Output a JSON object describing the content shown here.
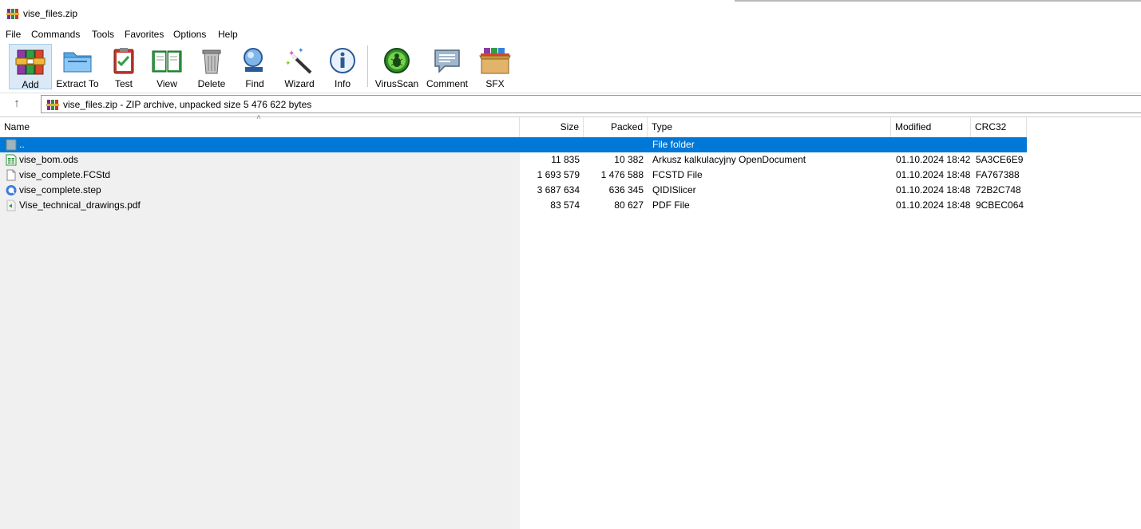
{
  "window": {
    "title": "vise_files.zip",
    "app_icon": "winrar-books-icon"
  },
  "menu": {
    "file": "File",
    "commands": "Commands",
    "tools": "Tools",
    "favorites": "Favorites",
    "options": "Options",
    "help": "Help"
  },
  "toolbar": {
    "add": "Add",
    "extract_to": "Extract To",
    "test": "Test",
    "view": "View",
    "delete": "Delete",
    "find": "Find",
    "wizard": "Wizard",
    "info": "Info",
    "virusscan": "VirusScan",
    "comment": "Comment",
    "sfx": "SFX"
  },
  "address": {
    "up_icon": "up-arrow-icon",
    "path": "vise_files.zip - ZIP archive, unpacked size 5 476 622 bytes"
  },
  "columns": {
    "name": "Name",
    "size": "Size",
    "packed": "Packed",
    "type": "Type",
    "modified": "Modified",
    "crc32": "CRC32"
  },
  "files": [
    {
      "name": "..",
      "size": "",
      "packed": "",
      "type": "File folder",
      "modified": "",
      "crc32": "",
      "icon": "parent-folder-icon"
    },
    {
      "name": "vise_bom.ods",
      "size": "11 835",
      "packed": "10 382",
      "type": "Arkusz kalkulacyjny OpenDocument",
      "modified": "01.10.2024 18:42",
      "crc32": "5A3CE6E9",
      "icon": "spreadsheet-icon"
    },
    {
      "name": "vise_complete.FCStd",
      "size": "1 693 579",
      "packed": "1 476 588",
      "type": "FCSTD File",
      "modified": "01.10.2024 18:48",
      "crc32": "FA767388",
      "icon": "blank-file-icon"
    },
    {
      "name": "vise_complete.step",
      "size": "3 687 634",
      "packed": "636 345",
      "type": "QIDISlicer",
      "modified": "01.10.2024 18:48",
      "crc32": "72B2C748",
      "icon": "slicer-icon"
    },
    {
      "name": "Vise_technical_drawings.pdf",
      "size": "83 574",
      "packed": "80 627",
      "type": "PDF File",
      "modified": "01.10.2024 18:48",
      "crc32": "9CBEC064",
      "icon": "pdf-file-icon"
    }
  ],
  "colors": {
    "selection": "#0078d7",
    "toolbar_active": "#dbe9f7"
  }
}
